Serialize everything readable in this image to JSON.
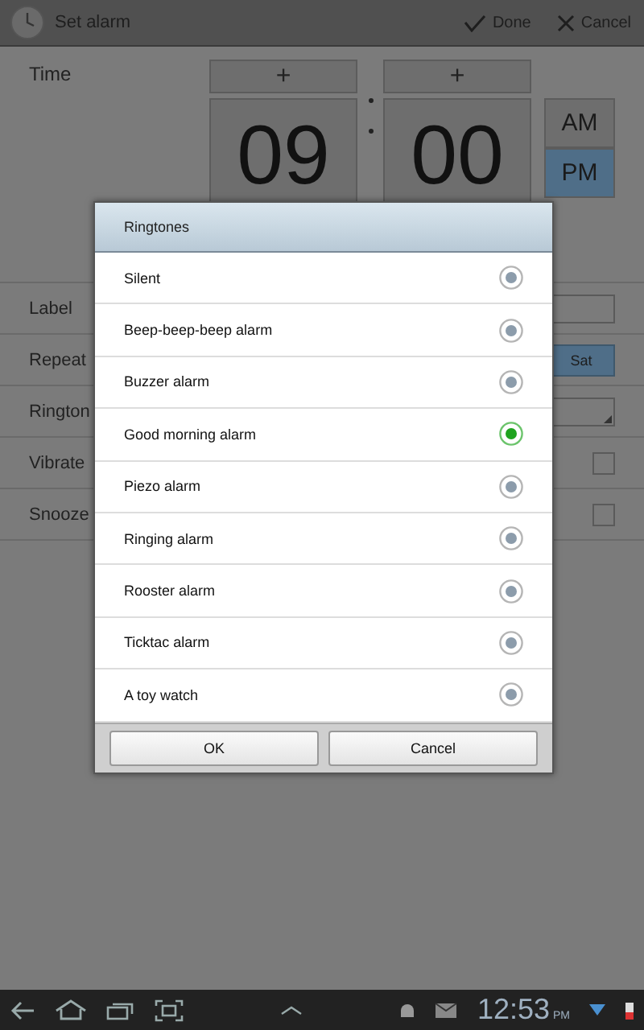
{
  "title_bar": {
    "title": "Set alarm",
    "actions": [
      {
        "kind": "done",
        "label": "Done"
      },
      {
        "kind": "cancel",
        "label": "Cancel"
      }
    ]
  },
  "time": {
    "label": "Time",
    "increments": [
      "+",
      "+"
    ],
    "hour": "09",
    "minute": "00",
    "meridiem": [
      {
        "label": "AM",
        "selected": false
      },
      {
        "label": "PM",
        "selected": true
      }
    ]
  },
  "settings": [
    {
      "kind": "field",
      "label": "Label"
    },
    {
      "kind": "days",
      "label": "Repeat",
      "days": [
        {
          "label": "Sat",
          "selected": true
        }
      ]
    },
    {
      "kind": "dropdown",
      "label": "Rington"
    },
    {
      "kind": "checkbox",
      "label": "Vibrate",
      "checked": false
    },
    {
      "kind": "checkbox",
      "label": "Snooze",
      "checked": false
    }
  ],
  "dialog": {
    "title": "Ringtones",
    "options": [
      {
        "label": "Silent",
        "selected": false
      },
      {
        "label": "Beep-beep-beep alarm",
        "selected": false
      },
      {
        "label": "Buzzer alarm",
        "selected": false
      },
      {
        "label": "Good morning alarm",
        "selected": true
      },
      {
        "label": "Piezo alarm",
        "selected": false
      },
      {
        "label": "Ringing alarm",
        "selected": false
      },
      {
        "label": "Rooster alarm",
        "selected": false
      },
      {
        "label": "Ticktac alarm",
        "selected": false
      },
      {
        "label": "A toy watch",
        "selected": false
      }
    ],
    "buttons": [
      "OK",
      "Cancel"
    ]
  },
  "status_bar": {
    "time": "12:53",
    "period": "PM"
  }
}
